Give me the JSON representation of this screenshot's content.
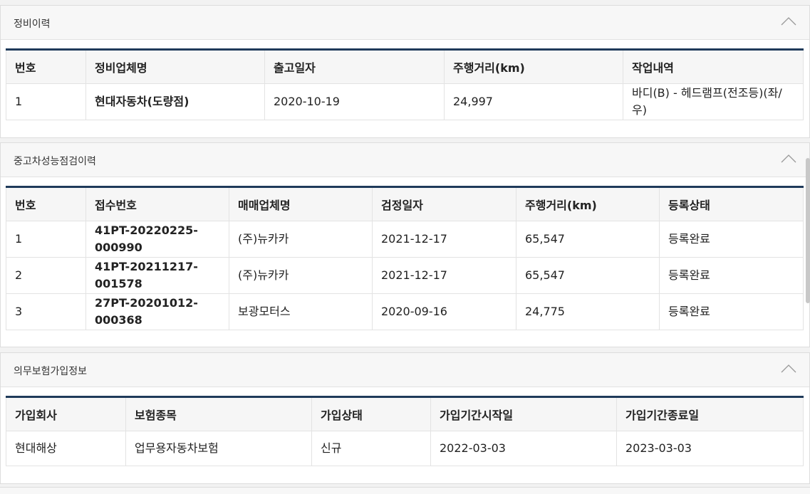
{
  "maintenance": {
    "title": "정비이력",
    "headers": [
      "번호",
      "정비업체명",
      "출고일자",
      "주행거리(km)",
      "작업내역"
    ],
    "rows": [
      [
        "1",
        "현대자동차(도량점)",
        "2020-10-19",
        "24,997",
        "바디(B) - 헤드램프(전조등)(좌/우)"
      ]
    ]
  },
  "inspection": {
    "title": "중고차성능점검이력",
    "headers": [
      "번호",
      "접수번호",
      "매매업체명",
      "검정일자",
      "주행거리(km)",
      "등록상태"
    ],
    "rows": [
      [
        "1",
        "41PT-20220225-000990",
        "(주)뉴카카",
        "2021-12-17",
        "65,547",
        "등록완료"
      ],
      [
        "2",
        "41PT-20211217-001578",
        "(주)뉴카카",
        "2021-12-17",
        "65,547",
        "등록완료"
      ],
      [
        "3",
        "27PT-20201012-000368",
        "보광모터스",
        "2020-09-16",
        "24,775",
        "등록완료"
      ]
    ]
  },
  "insurance": {
    "title": "의무보험가입정보",
    "headers": [
      "가입회사",
      "보험종목",
      "가입상태",
      "가입기간시작일",
      "가입기간종료일"
    ],
    "rows": [
      [
        "현대해상",
        "업무용자동차보험",
        "신규",
        "2022-03-03",
        "2023-03-03"
      ]
    ]
  },
  "icons": {
    "collapse": "chevron-up-icon"
  },
  "colors": {
    "header_border": "#1f3a5a",
    "panel_head_bg": "#f7f7f7"
  }
}
